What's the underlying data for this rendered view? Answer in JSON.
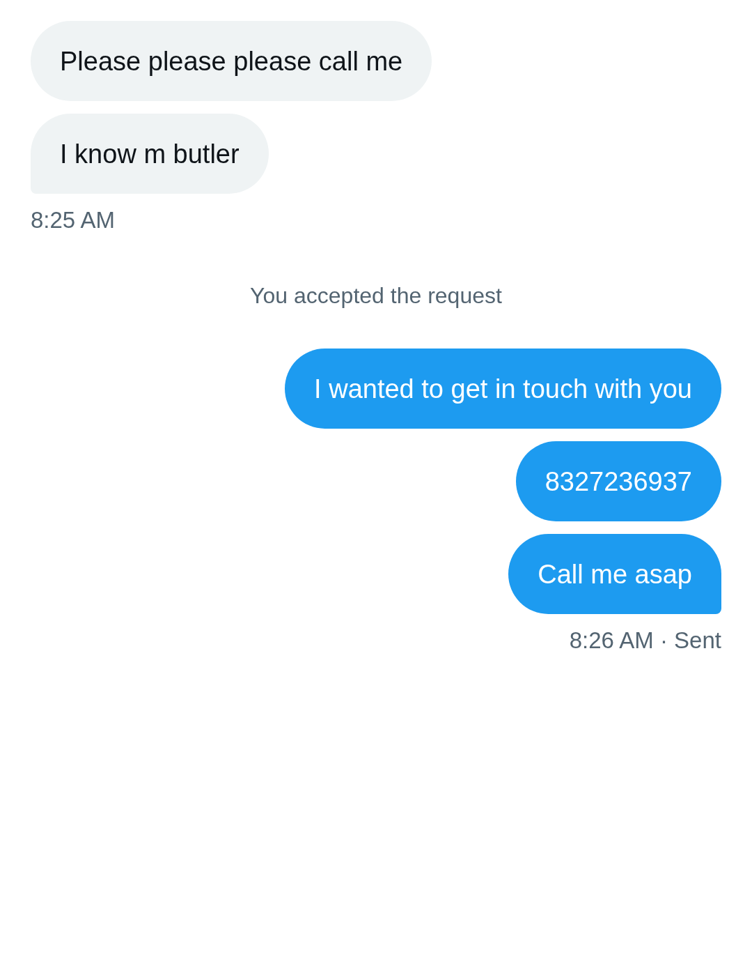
{
  "conversation": [
    {
      "kind": "received",
      "messages": [
        "Please please please call me",
        "I know m butler"
      ],
      "meta": "8:25 AM"
    },
    {
      "kind": "notice",
      "text": "You accepted the request"
    },
    {
      "kind": "sent",
      "messages": [
        "I wanted to get in touch with you",
        "8327236937",
        "Call me asap"
      ],
      "meta": "8:26 AM · Sent"
    }
  ]
}
